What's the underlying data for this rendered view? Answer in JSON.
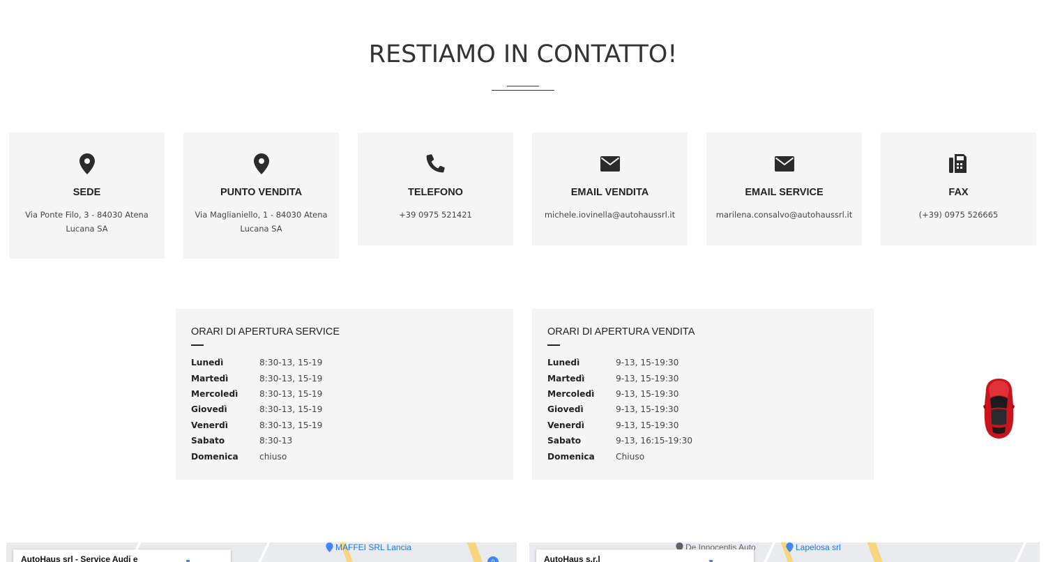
{
  "page": {
    "title": "RESTIAMO IN CONTATTO!"
  },
  "contacts": [
    {
      "icon": "map-marker-icon",
      "title": "SEDE",
      "value": "Via Ponte Filo, 3 - 84030 Atena Lucana SA"
    },
    {
      "icon": "map-marker-icon",
      "title": "PUNTO VENDITA",
      "value": "Via Maglianiello, 1 - 84030 Atena Lucana SA"
    },
    {
      "icon": "phone-icon",
      "title": "TELEFONO",
      "value": "+39 0975 521421"
    },
    {
      "icon": "envelope-icon",
      "title": "EMAIL VENDITA",
      "value": "michele.iovinella@autohaussrl.it"
    },
    {
      "icon": "envelope-icon",
      "title": "EMAIL SERVICE",
      "value": "marilena.consalvo@autohaussrl.it"
    },
    {
      "icon": "fax-icon",
      "title": "FAX",
      "value": "(+39) 0975 526665"
    }
  ],
  "hours_service": {
    "title": "ORARI DI APERTURA SERVICE",
    "rows": [
      {
        "day": "Lunedì",
        "time": "8:30-13, 15-19"
      },
      {
        "day": "Martedì",
        "time": "8:30-13, 15-19"
      },
      {
        "day": "Mercoledì",
        "time": "8:30-13, 15-19"
      },
      {
        "day": "Giovedì",
        "time": "8:30-13, 15-19"
      },
      {
        "day": "Venerdì",
        "time": "8:30-13, 15-19"
      },
      {
        "day": "Sabato",
        "time": "8:30-13"
      },
      {
        "day": "Domenica",
        "time": "chiuso"
      }
    ]
  },
  "hours_vendita": {
    "title": "ORARI DI APERTURA VENDITA",
    "rows": [
      {
        "day": "Lunedì",
        "time": "9-13, 15-19:30"
      },
      {
        "day": "Martedì",
        "time": "9-13, 15-19:30"
      },
      {
        "day": "Mercoledì",
        "time": "9-13, 15-19:30"
      },
      {
        "day": "Giovedì",
        "time": "9-13, 15-19:30"
      },
      {
        "day": "Venerdì",
        "time": "9-13, 15-19:30"
      },
      {
        "day": "Sabato",
        "time": "9-13, 16:15-19:30"
      },
      {
        "day": "Domenica",
        "time": "Chiuso"
      }
    ]
  },
  "maps": [
    {
      "info_title": "AutoHaus srl - Service Audi e",
      "places": [
        "MAFFEI SRL Lancia"
      ],
      "badge": "0"
    },
    {
      "info_title": "AutoHaus s.r.l",
      "places": [
        "De Innocentis Auto",
        "Lapelosa srl"
      ]
    }
  ],
  "floating": {
    "icon": "red-car-icon"
  },
  "colors": {
    "card_bg": "#f5f5f5",
    "text": "#2b2b2b",
    "map_bg": "#e9ebee",
    "car_red": "#c8141c"
  }
}
